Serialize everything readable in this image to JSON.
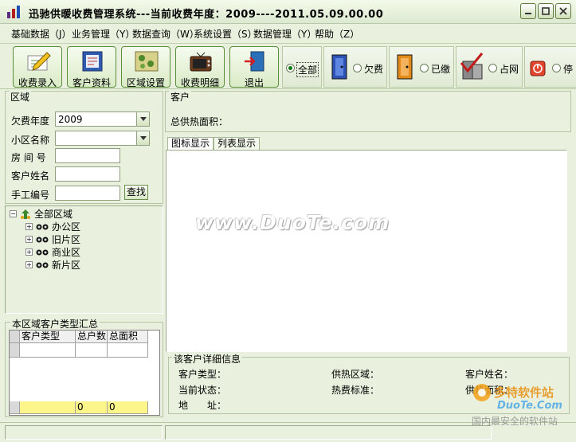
{
  "window": {
    "title": "迅驰供暖收费管理系统---当前收费年度：2009----2011.05.09.00.00"
  },
  "menu": [
    "基础数据（J）",
    "业务管理（Y）",
    "数据查询（W）",
    "系统设置（S）",
    "数据管理（Y）",
    "帮助（Z）"
  ],
  "toolbar": {
    "buttons": [
      "收费录入",
      "客户资料",
      "区域设置",
      "收费明细",
      "退出"
    ],
    "filters": [
      {
        "label": "全部",
        "selected": true
      },
      {
        "label": "欠费",
        "selected": false
      },
      {
        "label": "已缴",
        "selected": false
      },
      {
        "label": "占网",
        "selected": false
      },
      {
        "label": "停",
        "selected": false
      }
    ]
  },
  "region_panel": {
    "header": "区域",
    "year_label": "欠费年度",
    "year_value": "2009",
    "community_label": "小区名称",
    "room_label": "房 间 号",
    "name_label": "客户姓名",
    "code_label": "手工编号",
    "search_button": "查找"
  },
  "tree": {
    "root": "全部区域",
    "children": [
      "办公区",
      "旧片区",
      "商业区",
      "新片区"
    ]
  },
  "summary": {
    "header": "本区域客户类型汇总",
    "columns": [
      "客户类型",
      "总户数",
      "总面积"
    ],
    "totals": [
      "",
      "0",
      "0"
    ]
  },
  "customer_panel": {
    "header": "客户",
    "total_area_label": "总供热面积：",
    "tabs": [
      "图标显示",
      "列表显示"
    ],
    "watermark": "www.DuoTe.com"
  },
  "details": {
    "header": "该客户详细信息",
    "fields": [
      "客户类型：",
      "供热区域：",
      "客户姓名：",
      "当前状态：",
      "热费标准：",
      "供热面积：",
      "地　　址："
    ]
  },
  "brand": {
    "name": "多特软件站",
    "url": "DuoTe.Com",
    "tagline": "国内最安全的软件站"
  }
}
